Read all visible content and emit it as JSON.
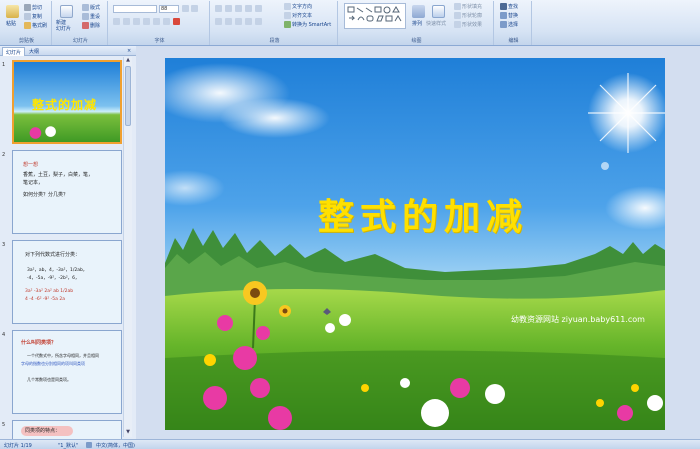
{
  "ribbon": {
    "clipboard": {
      "label": "剪贴板",
      "paste": "粘贴",
      "cut": "剪切",
      "copy": "复制",
      "format": "格式刷"
    },
    "slides": {
      "label": "幻灯片",
      "new_slide": "新建\n幻灯片",
      "layout": "版式",
      "reset": "重设",
      "delete": "删除"
    },
    "font": {
      "label": "字体",
      "font_size": "88"
    },
    "paragraph": {
      "label": "段落",
      "text_direction": "文字方向",
      "align_text": "对齐文本",
      "smartart": "转换为 SmartArt"
    },
    "drawing": {
      "label": "绘图",
      "arrange": "排列",
      "quick_styles": "快速样式",
      "shape_fill": "形状填充",
      "shape_outline": "形状轮廓",
      "shape_effects": "形状效果"
    },
    "editing": {
      "label": "编辑",
      "find": "查找",
      "replace": "替换",
      "select": "选择"
    }
  },
  "panel": {
    "tab_slides": "幻灯片",
    "tab_outline": "大纲"
  },
  "thumbnails": [
    {
      "num": "1",
      "title": "整式的加减"
    },
    {
      "num": "2",
      "lines": [
        "想一想",
        "香蕉，土豆，梨子，白菜，笔，",
        "笔记本，",
        "如何分类？分几类？"
      ]
    },
    {
      "num": "3",
      "lines": [
        "对下列代数式进行分类：",
        "3a²，ab，4，-3a²，1/2ab，",
        "-4，-5a，-9²，-2b²，6，",
        "3a² -3a² 2a²    ab 1/2ab",
        "4 -4 -6² -9²     -5a 2a"
      ]
    },
    {
      "num": "4",
      "lines": [
        "什么叫同类项？",
        "一个代数式中，所含字母相同，并且相同",
        "字母的指数也分别相同的项叫同类项",
        "几个常数项也是同类项。"
      ]
    },
    {
      "num": "5",
      "lines": [
        "同类项的特点："
      ]
    }
  ],
  "slide": {
    "title": "整式的加减",
    "watermark": "幼教资源网站 ziyuan.baby611.com"
  },
  "status": {
    "slide_counter": "幻灯片 1/19",
    "theme": "\"1_默认\"",
    "language": "中文(简体，中国)"
  }
}
